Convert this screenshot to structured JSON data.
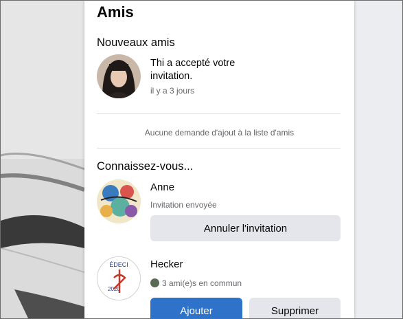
{
  "panel": {
    "title": "Amis",
    "new_friends_title": "Nouveaux amis",
    "new_friend": {
      "message": "Thi a accepté votre invitation.",
      "time": "il y a 3 jours"
    },
    "no_requests": "Aucune demande d'ajout à la liste d'amis",
    "suggestions_title": "Connaissez-vous...",
    "suggestions": [
      {
        "name": "Anne",
        "status": "Invitation envoyée",
        "button": "Annuler l'invitation"
      },
      {
        "name": "Hecker",
        "mutual": "3 ami(e)s en commun",
        "logo_top": "ÉDECI",
        "logo_year": "2020",
        "add_button": "Ajouter",
        "remove_button": "Supprimer"
      }
    ]
  },
  "colors": {
    "primary": "#2e73c9",
    "secondary_button": "#e4e6eb",
    "muted_text": "#65676b"
  }
}
